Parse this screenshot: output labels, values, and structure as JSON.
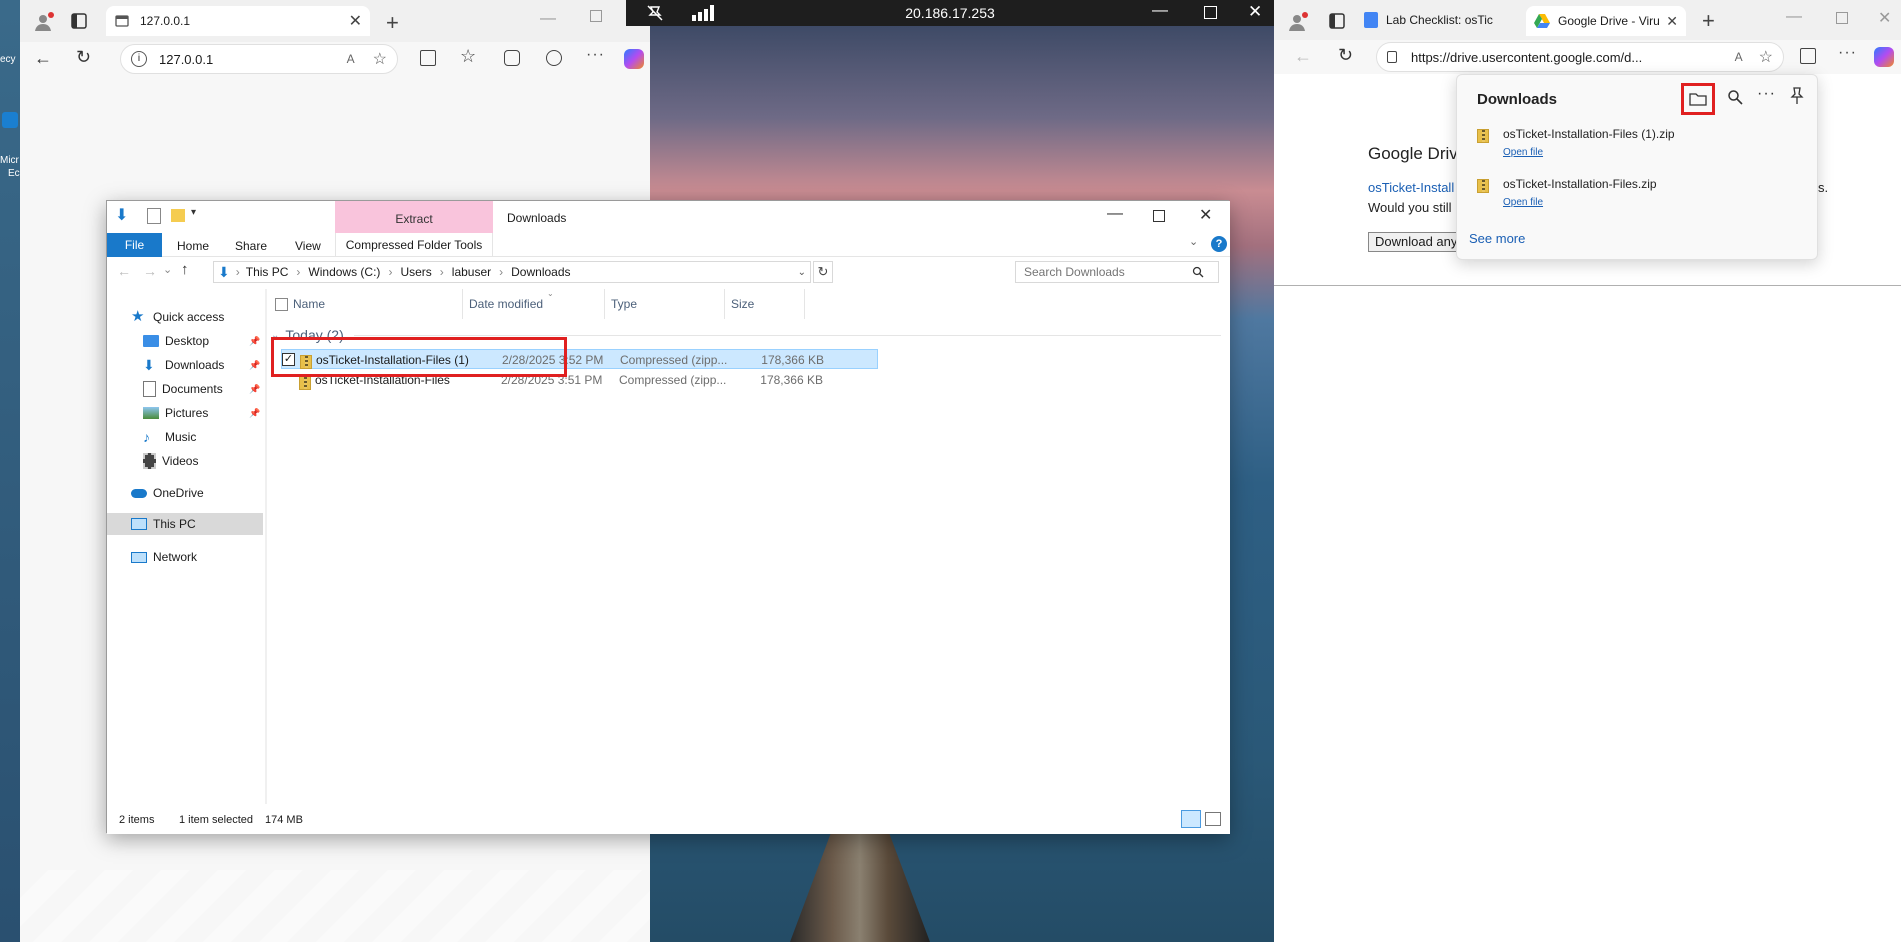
{
  "browser_left": {
    "tab_title": "127.0.0.1",
    "address": "127.0.0.1"
  },
  "remote_bar": {
    "ip": "20.186.17.253"
  },
  "desktop": {
    "left_labels": [
      "Micr",
      "Ec",
      "ecy"
    ]
  },
  "browser_right": {
    "tabs": [
      {
        "label": "Lab Checklist: osTic"
      },
      {
        "label": "Google Drive - Viru"
      }
    ],
    "address": "https://drive.usercontent.google.com/d...",
    "page": {
      "heading": "Google Drive",
      "link": "osTicket-Install",
      "question": "Would you still",
      "button": "Download any",
      "trailing": "s."
    }
  },
  "downloads_panel": {
    "title": "Downloads",
    "items": [
      {
        "name": "osTicket-Installation-Files (1).zip",
        "action": "Open file"
      },
      {
        "name": "osTicket-Installation-Files.zip",
        "action": "Open file"
      }
    ],
    "see_more": "See more"
  },
  "explorer": {
    "title": "Downloads",
    "context_tab": "Extract",
    "tabs": [
      "File",
      "Home",
      "Share",
      "View",
      "Compressed Folder Tools"
    ],
    "breadcrumb": [
      "This PC",
      "Windows (C:)",
      "Users",
      "labuser",
      "Downloads"
    ],
    "search_placeholder": "Search Downloads",
    "nav": {
      "quick_access": "Quick access",
      "items": [
        "Desktop",
        "Downloads",
        "Documents",
        "Pictures",
        "Music",
        "Videos"
      ],
      "onedrive": "OneDrive",
      "this_pc": "This PC",
      "network": "Network"
    },
    "columns": [
      "Name",
      "Date modified",
      "Type",
      "Size"
    ],
    "group": "Today (2)",
    "files": [
      {
        "name": "osTicket-Installation-Files (1)",
        "date": "2/28/2025 3:52 PM",
        "type": "Compressed (zipp...",
        "size": "178,366 KB",
        "selected": true
      },
      {
        "name": "osTicket-Installation-Files",
        "date": "2/28/2025 3:51 PM",
        "type": "Compressed (zipp...",
        "size": "178,366 KB",
        "selected": false
      }
    ],
    "status": {
      "count": "2 items",
      "selected": "1 item selected",
      "size": "174 MB"
    }
  },
  "colors": {
    "highlight_box": "#e02020",
    "selection": "#cce8ff",
    "file_tab": "#1979ca",
    "context_tab": "#f9c4dc",
    "link": "#1a5fb4"
  }
}
